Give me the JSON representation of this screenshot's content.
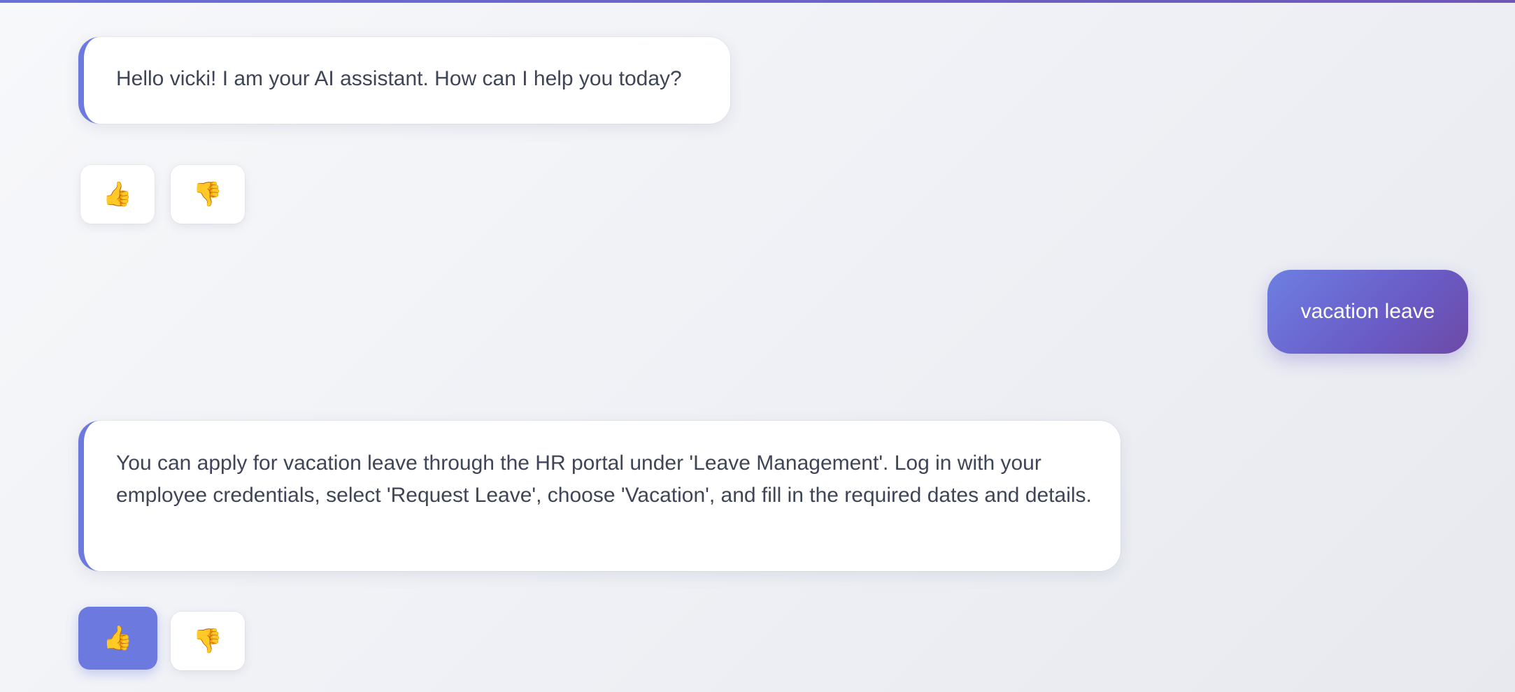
{
  "conversation": {
    "messages": [
      {
        "role": "bot",
        "text": "Hello vicki! I am your AI assistant. How can I help you today?"
      },
      {
        "role": "user",
        "text": "vacation leave"
      },
      {
        "role": "bot",
        "text": "You can apply for vacation leave through the HR portal under 'Leave Management'. Log in with your employee credentials, select 'Request Leave', choose 'Vacation', and fill in the required dates and details."
      }
    ],
    "feedback": [
      {
        "thumbs_up_icon": "thumbs-up-icon",
        "thumbs_down_icon": "thumbs-down-icon",
        "selected": "none"
      },
      {
        "thumbs_up_icon": "thumbs-up-icon",
        "thumbs_down_icon": "thumbs-down-icon",
        "selected": "up"
      }
    ]
  },
  "icons": {
    "thumbs_up": "👍",
    "thumbs_down": "👎"
  },
  "colors": {
    "accent": "#6c7ae0",
    "user_bubble_start": "#6d7fe2",
    "user_bubble_end": "#6d4aa6",
    "bot_text": "#3d4556"
  }
}
